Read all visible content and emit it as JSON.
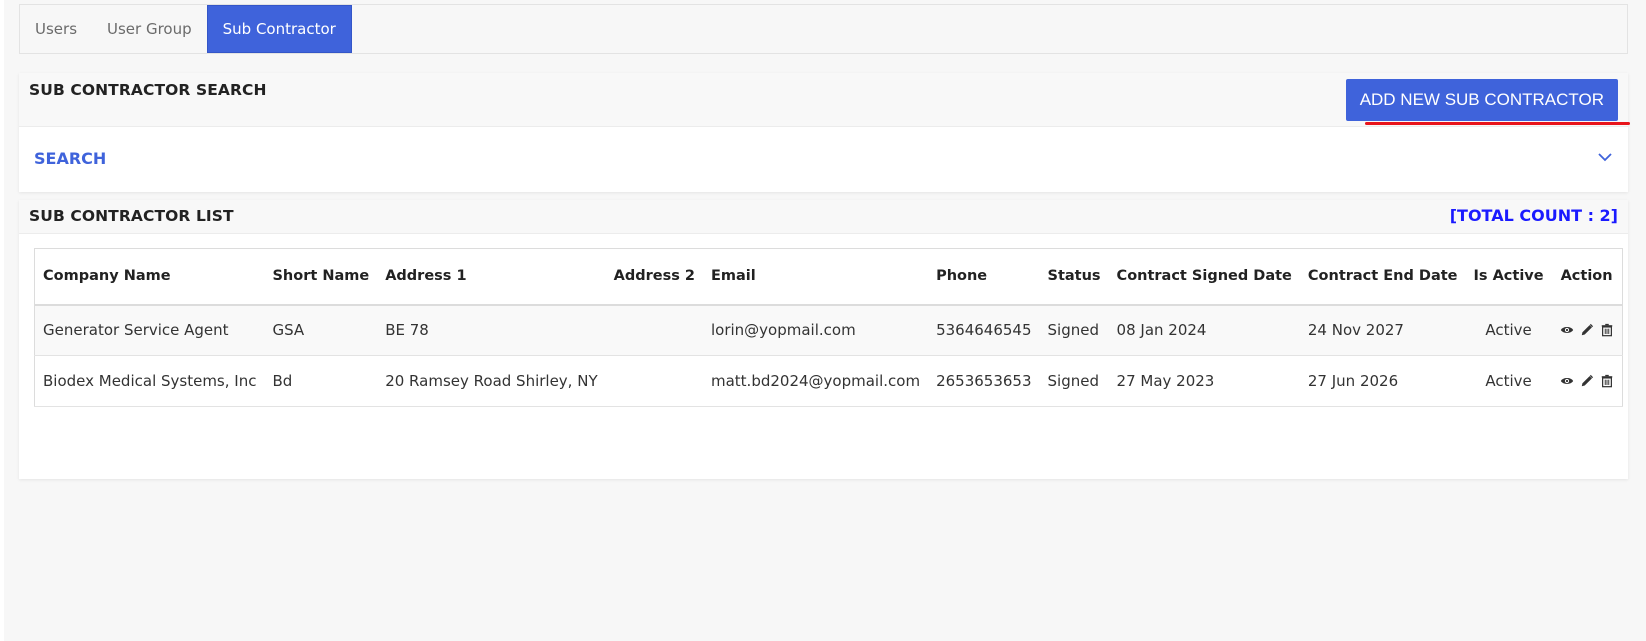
{
  "tabs": [
    {
      "label": "Users",
      "active": false
    },
    {
      "label": "User Group",
      "active": false
    },
    {
      "label": "Sub Contractor",
      "active": true
    }
  ],
  "search_card": {
    "title": "SUB CONTRACTOR SEARCH",
    "add_button_label": "ADD NEW SUB CONTRACTOR",
    "search_label": "SEARCH",
    "toggle_icon": "chevron-down-icon"
  },
  "list_card": {
    "title": "SUB CONTRACTOR LIST",
    "total_count": "[TOTAL COUNT : 2]"
  },
  "table": {
    "columns": [
      "Company Name",
      "Short Name",
      "Address 1",
      "Address 2",
      "Email",
      "Phone",
      "Status",
      "Contract Signed Date",
      "Contract End Date",
      "Is Active",
      "Action"
    ],
    "rows": [
      {
        "company_name": "Generator Service Agent",
        "short_name": "GSA",
        "address1": "BE 78",
        "address2": "",
        "email": "lorin@yopmail.com",
        "phone": "5364646545",
        "status": "Signed",
        "signed_date": "08 Jan 2024",
        "end_date": "24 Nov 2027",
        "is_active": "Active",
        "action_icons": [
          "eye-icon",
          "pencil-icon",
          "trash-icon"
        ]
      },
      {
        "company_name": "Biodex Medical Systems, Inc",
        "short_name": "Bd",
        "address1": "20 Ramsey Road Shirley, NY",
        "address2": "",
        "email": "matt.bd2024@yopmail.com",
        "phone": "2653653653",
        "status": "Signed",
        "signed_date": "27 May 2023",
        "end_date": "27 Jun 2026",
        "is_active": "Active",
        "action_icons": [
          "eye-icon",
          "pencil-icon",
          "trash-icon"
        ]
      }
    ]
  },
  "colors": {
    "accent": "#3f63db",
    "count": "#1a1aff",
    "highlight_underline": "#e8141b"
  }
}
